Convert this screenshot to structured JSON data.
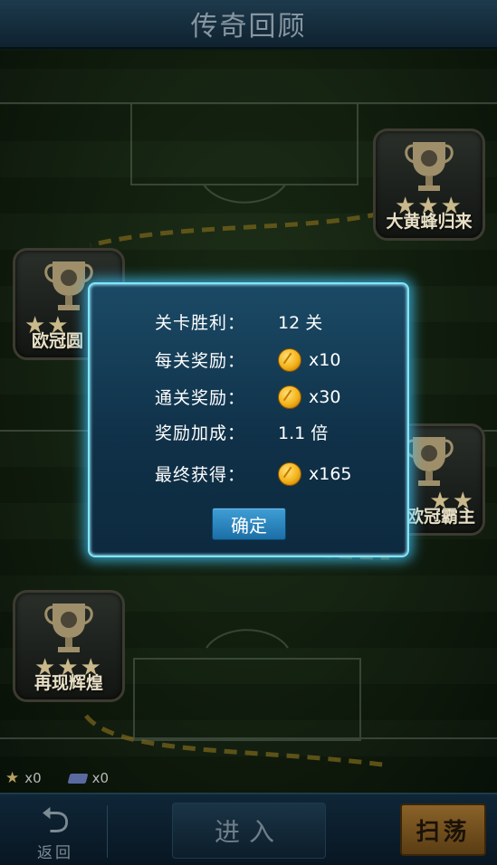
{
  "header": {
    "title": "传奇回顾"
  },
  "trophies": [
    {
      "name": "大黄蜂归来",
      "stars": "★★★"
    },
    {
      "name": "欧冠圆",
      "stars": "★★"
    },
    {
      "name": "欧冠霸主",
      "stars": "★★"
    },
    {
      "name": "再现辉煌",
      "stars": "★★★"
    }
  ],
  "inventory": {
    "stars": "x0",
    "tickets": "x0"
  },
  "dialog": {
    "rows": [
      {
        "label": "关卡胜利：",
        "value": "12 关"
      },
      {
        "label": "每关奖励：",
        "value": "x10",
        "coin": true
      },
      {
        "label": "通关奖励：",
        "value": "x30",
        "coin": true
      },
      {
        "label": "奖励加成：",
        "value": "1.1 倍"
      },
      {
        "label": "最终获得：",
        "value": "x165",
        "coin": true
      }
    ],
    "confirm_label": "确定"
  },
  "footer": {
    "back_label": "返回",
    "enter_label": "进入",
    "sweep_label": "扫荡"
  },
  "colors": {
    "dialog_glow": "#40c8ff",
    "coin": "#f3b21a",
    "sweep_button": "#8a6228"
  },
  "icons": {
    "back": "undo-arrow-icon",
    "coin": "gold-coin-icon",
    "trophy": "trophy-cup-icon",
    "star": "star-icon",
    "ticket": "ticket-icon"
  }
}
